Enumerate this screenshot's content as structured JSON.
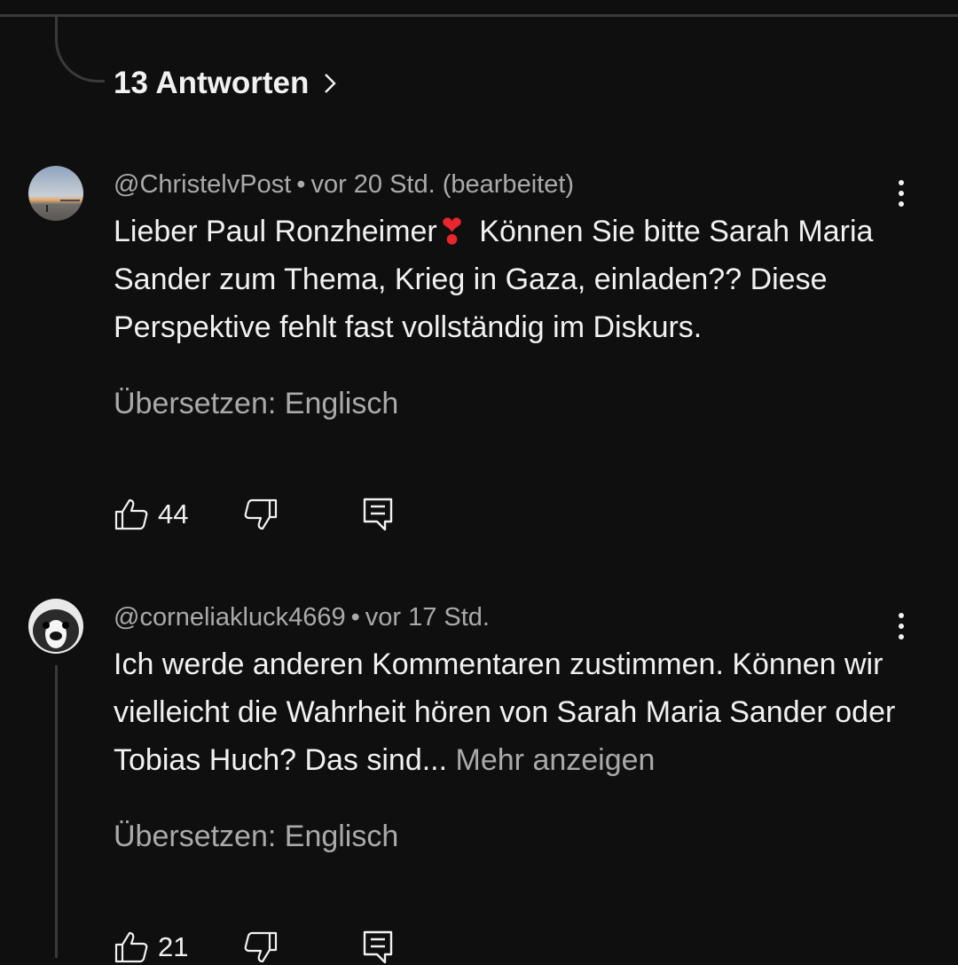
{
  "thread": {
    "replies_label": "13 Antworten"
  },
  "comments": [
    {
      "author": "@ChristelvPost",
      "separator": "•",
      "time": "vor 20 Std. (bearbeitet)",
      "text_before": "Lieber Paul Ronzheimer",
      "emoji": "❣",
      "text_after": "Können Sie bitte Sarah Maria Sander zum Thema, Krieg in Gaza, einladen?? Diese Perspektive fehlt fast vollständig im Diskurs.",
      "translate_label": "Übersetzen: Englisch",
      "likes": "44"
    },
    {
      "author": "@corneliakluck4669",
      "separator": "•",
      "time": "vor 17 Std.",
      "text": "Ich werde anderen Kommentaren zustimmen. Können wir vielleicht die Wahrheit hören von Sarah Maria Sander oder Tobias Huch? Das sind...",
      "more_label": "Mehr anzeigen",
      "translate_label": "Übersetzen: Englisch",
      "likes": "21"
    }
  ],
  "icons": {
    "like": "thumb-up-icon",
    "dislike": "thumb-down-icon",
    "reply": "reply-comment-icon",
    "menu": "more-vertical-icon",
    "chevron": "chevron-right-icon"
  },
  "colors": {
    "background": "#0f0f0f",
    "text": "#f1f1f1",
    "secondary": "#aaaaaa",
    "heart": "#e8262e"
  }
}
